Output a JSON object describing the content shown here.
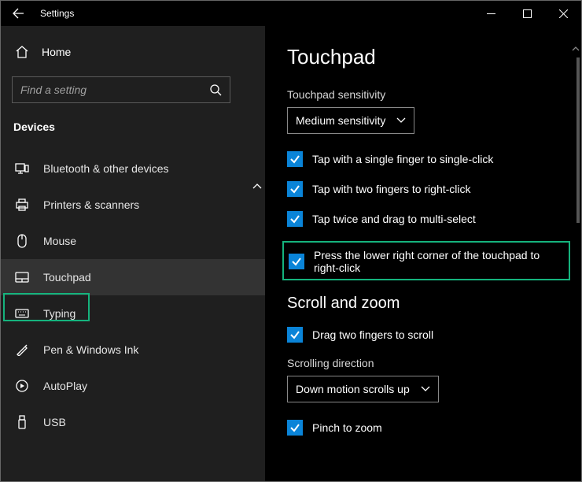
{
  "window": {
    "title": "Settings"
  },
  "sidebar": {
    "home": "Home",
    "search_placeholder": "Find a setting",
    "category": "Devices",
    "items": [
      {
        "label": "Bluetooth & other devices"
      },
      {
        "label": "Printers & scanners"
      },
      {
        "label": "Mouse"
      },
      {
        "label": "Touchpad",
        "selected": true
      },
      {
        "label": "Typing"
      },
      {
        "label": "Pen & Windows Ink"
      },
      {
        "label": "AutoPlay"
      },
      {
        "label": "USB"
      }
    ]
  },
  "main": {
    "heading": "Touchpad",
    "sensitivity_label": "Touchpad sensitivity",
    "sensitivity_value": "Medium sensitivity",
    "taps": [
      "Tap with a single finger to single-click",
      "Tap with two fingers to right-click",
      "Tap twice and drag to multi-select"
    ],
    "lower_right": "Press the lower right corner of the touchpad to right-click",
    "scroll_heading": "Scroll and zoom",
    "drag_two_fingers": "Drag two fingers to scroll",
    "scroll_dir_label": "Scrolling direction",
    "scroll_dir_value": "Down motion scrolls up",
    "pinch": "Pinch to zoom"
  }
}
